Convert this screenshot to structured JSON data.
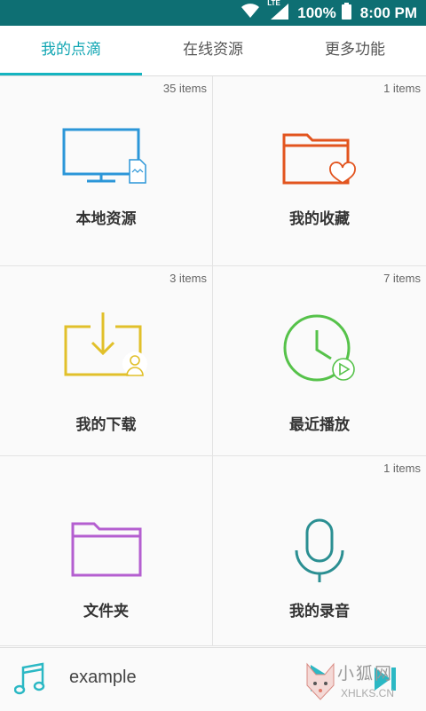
{
  "status_bar": {
    "network": "LTE",
    "battery_percent": "100%",
    "time": "8:00 PM",
    "icons": [
      "wifi-icon",
      "signal-icon",
      "battery-icon"
    ]
  },
  "tabs": [
    {
      "label": "我的点滴",
      "active": true
    },
    {
      "label": "在线资源",
      "active": false
    },
    {
      "label": "更多功能",
      "active": false
    }
  ],
  "accent_color": "#15b4c0",
  "grid": [
    {
      "label": "本地资源",
      "count": "35 items",
      "icon": "monitor-icon",
      "color": "#2b96d8"
    },
    {
      "label": "我的收藏",
      "count": "1 items",
      "icon": "folder-heart-icon",
      "color": "#e2541e"
    },
    {
      "label": "我的下载",
      "count": "3 items",
      "icon": "download-icon",
      "color": "#e1c02a"
    },
    {
      "label": "最近播放",
      "count": "7 items",
      "icon": "clock-play-icon",
      "color": "#56c24a"
    },
    {
      "label": "文件夹",
      "count": "",
      "icon": "folder-icon",
      "color": "#b45fd0"
    },
    {
      "label": "我的录音",
      "count": "1 items",
      "icon": "microphone-icon",
      "color": "#2b8f92"
    }
  ],
  "player": {
    "title": "example",
    "icons": [
      "music-note-icon",
      "play-icon",
      "next-icon"
    ]
  },
  "watermark": {
    "text_cn": "小狐网",
    "text_en": "XHLKS.CN"
  }
}
